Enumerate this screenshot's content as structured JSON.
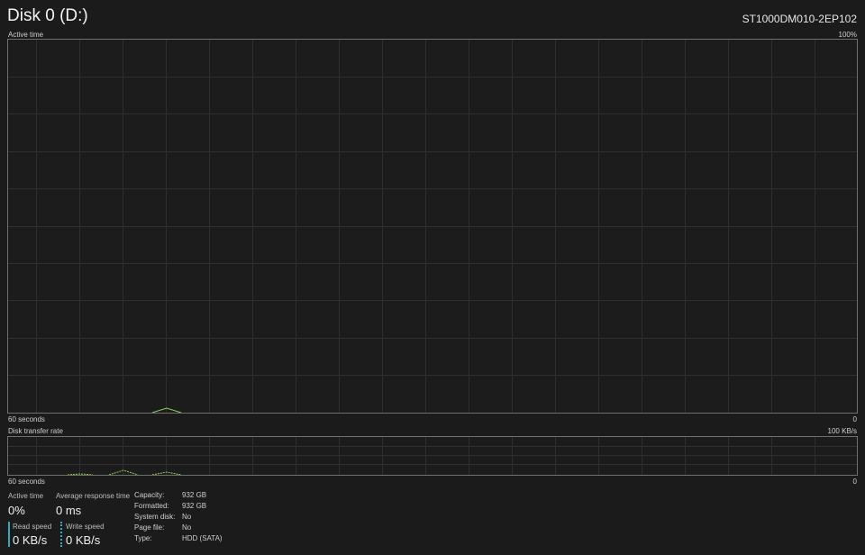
{
  "header": {
    "title": "Disk 0 (D:)",
    "model": "ST1000DM010-2EP102"
  },
  "active_time_graph": {
    "label": "Active time",
    "max_label": "100%",
    "time_label": "60 seconds",
    "min_label": "0",
    "line_color": "#8fd14f"
  },
  "transfer_rate_graph": {
    "label": "Disk transfer rate",
    "max_label": "100 KB/s",
    "time_label": "60 seconds",
    "min_label": "0",
    "line_color": "#8fd14f"
  },
  "stats": {
    "active_time": {
      "label": "Active time",
      "value": "0%"
    },
    "avg_response": {
      "label": "Average response time",
      "value": "0 ms"
    },
    "read_speed": {
      "label": "Read speed",
      "value": "0 KB/s",
      "color": "#3aa6b9"
    },
    "write_speed": {
      "label": "Write speed",
      "value": "0 KB/s",
      "color": "#3aa6b9"
    }
  },
  "properties": [
    {
      "label": "Capacity:",
      "value": "932 GB"
    },
    {
      "label": "Formatted:",
      "value": "932 GB"
    },
    {
      "label": "System disk:",
      "value": "No"
    },
    {
      "label": "Page file:",
      "value": "No"
    },
    {
      "label": "Type:",
      "value": "HDD (SATA)"
    }
  ]
}
